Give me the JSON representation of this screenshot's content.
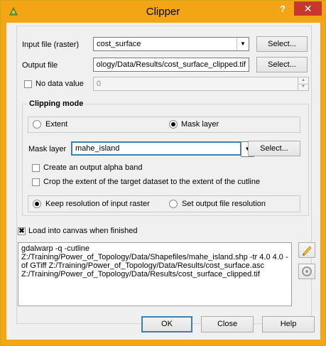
{
  "window": {
    "title": "Clipper",
    "help_label": "?",
    "close_label": "✕",
    "accent": "#f4a516"
  },
  "input": {
    "label": "Input file (raster)",
    "value": "cost_surface",
    "select_label": "Select..."
  },
  "output": {
    "label": "Output file",
    "value": "ology/Data/Results/cost_surface_clipped.tif",
    "select_label": "Select..."
  },
  "nodata": {
    "label": "No data value",
    "value": "0",
    "checked": false
  },
  "clipping": {
    "group_label": "Clipping mode",
    "extent_label": "Extent",
    "mask_label": "Mask layer",
    "selected": "Mask layer",
    "mask_layer_label": "Mask layer",
    "mask_layer_value": "mahe_island",
    "mask_select_label": "Select...",
    "alpha_label": "Create an output alpha band",
    "crop_label": "Crop the extent of the target dataset to the extent of the cutline",
    "keep_res_label": "Keep resolution of input raster",
    "set_res_label": "Set output file resolution"
  },
  "load": {
    "label": "Load into canvas when finished",
    "checked": true
  },
  "command": "gdalwarp -q -cutline\nZ:/Training/Power_of_Topology/Data/Shapefiles/mahe_island.shp -tr 4.0 4.0 -of GTiff Z:/Training/Power_of_Topology/Data/Results/cost_surface.asc\nZ:/Training/Power_of_Topology/Data/Results/cost_surface_clipped.tif",
  "buttons": {
    "ok": "OK",
    "close": "Close",
    "help": "Help"
  }
}
